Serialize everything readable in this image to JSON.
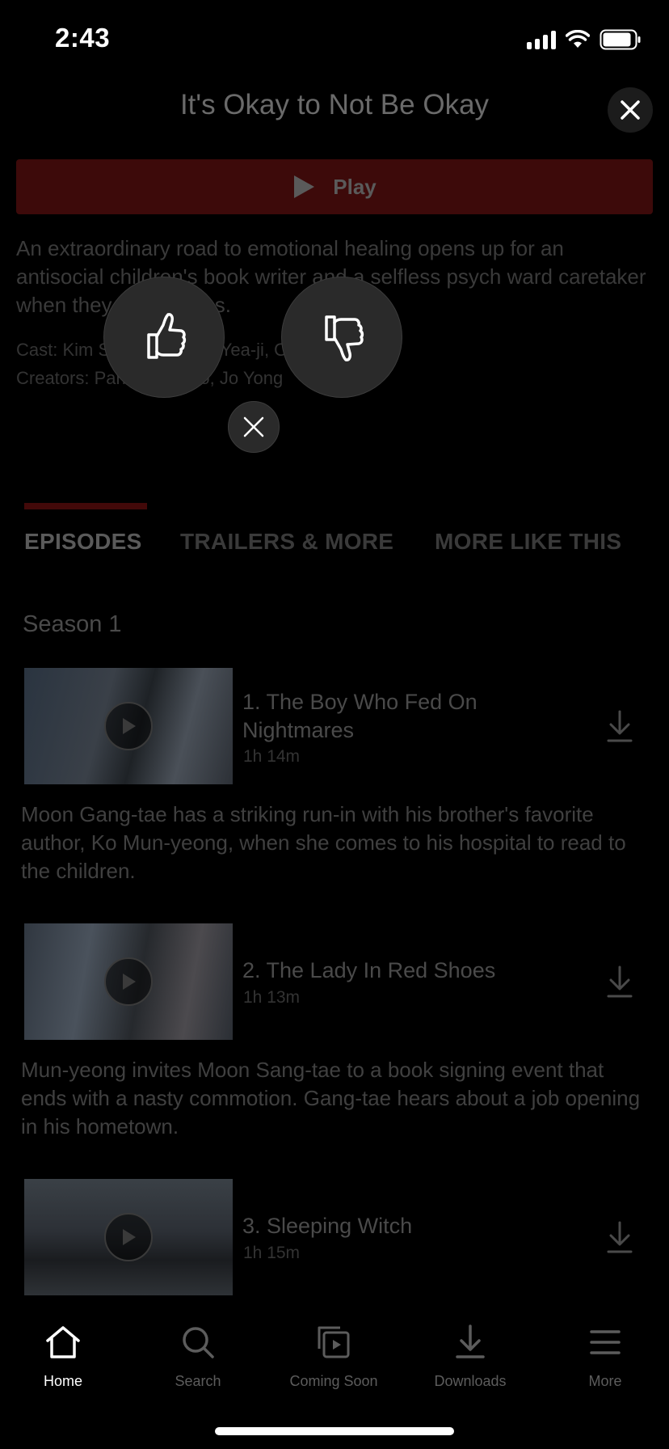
{
  "status_bar": {
    "time": "2:43"
  },
  "header": {
    "title": "It's Okay to Not Be Okay"
  },
  "play_button": {
    "label": "Play"
  },
  "synopsis": "An extraordinary road to emotional healing opens up for an antisocial children's book writer and a selfless psych ward caretaker when they cross paths.",
  "cast": "Cast: Kim Soo-hyun, Seo Yea-ji, Oh Jung-se",
  "creators": "Creators: Park Shin-woo, Jo Yong",
  "tabs": [
    {
      "label": "EPISODES",
      "active": true
    },
    {
      "label": "TRAILERS & MORE",
      "active": false
    },
    {
      "label": "MORE LIKE THIS",
      "active": false
    }
  ],
  "season": "Season 1",
  "episodes": [
    {
      "title": "1. The Boy Who Fed On Nightmares",
      "duration": "1h 14m",
      "description": "Moon Gang-tae has a striking run-in with his brother's favorite author, Ko Mun-yeong, when she comes to his hospital to read to the children."
    },
    {
      "title": "2. The Lady In Red Shoes",
      "duration": "1h 13m",
      "description": "Mun-yeong invites Moon Sang-tae to a book signing event that ends with a nasty commotion. Gang-tae hears about a job opening in his hometown."
    },
    {
      "title": "3. Sleeping Witch",
      "duration": "1h 15m"
    }
  ],
  "rating_overlay": {
    "like_icon": "thumbs-up-icon",
    "dislike_icon": "thumbs-down-icon",
    "dismiss_icon": "close-icon"
  },
  "bottom_nav": [
    {
      "label": "Home",
      "icon": "home-icon",
      "active": true
    },
    {
      "label": "Search",
      "icon": "search-icon",
      "active": false
    },
    {
      "label": "Coming Soon",
      "icon": "coming-soon-icon",
      "active": false
    },
    {
      "label": "Downloads",
      "icon": "download-icon",
      "active": false
    },
    {
      "label": "More",
      "icon": "menu-icon",
      "active": false
    }
  ],
  "colors": {
    "background": "#000000",
    "play_button_dimmed": "#3d0a0a",
    "tab_indicator": "#420909",
    "overlay_button": "#2a2a2a"
  }
}
